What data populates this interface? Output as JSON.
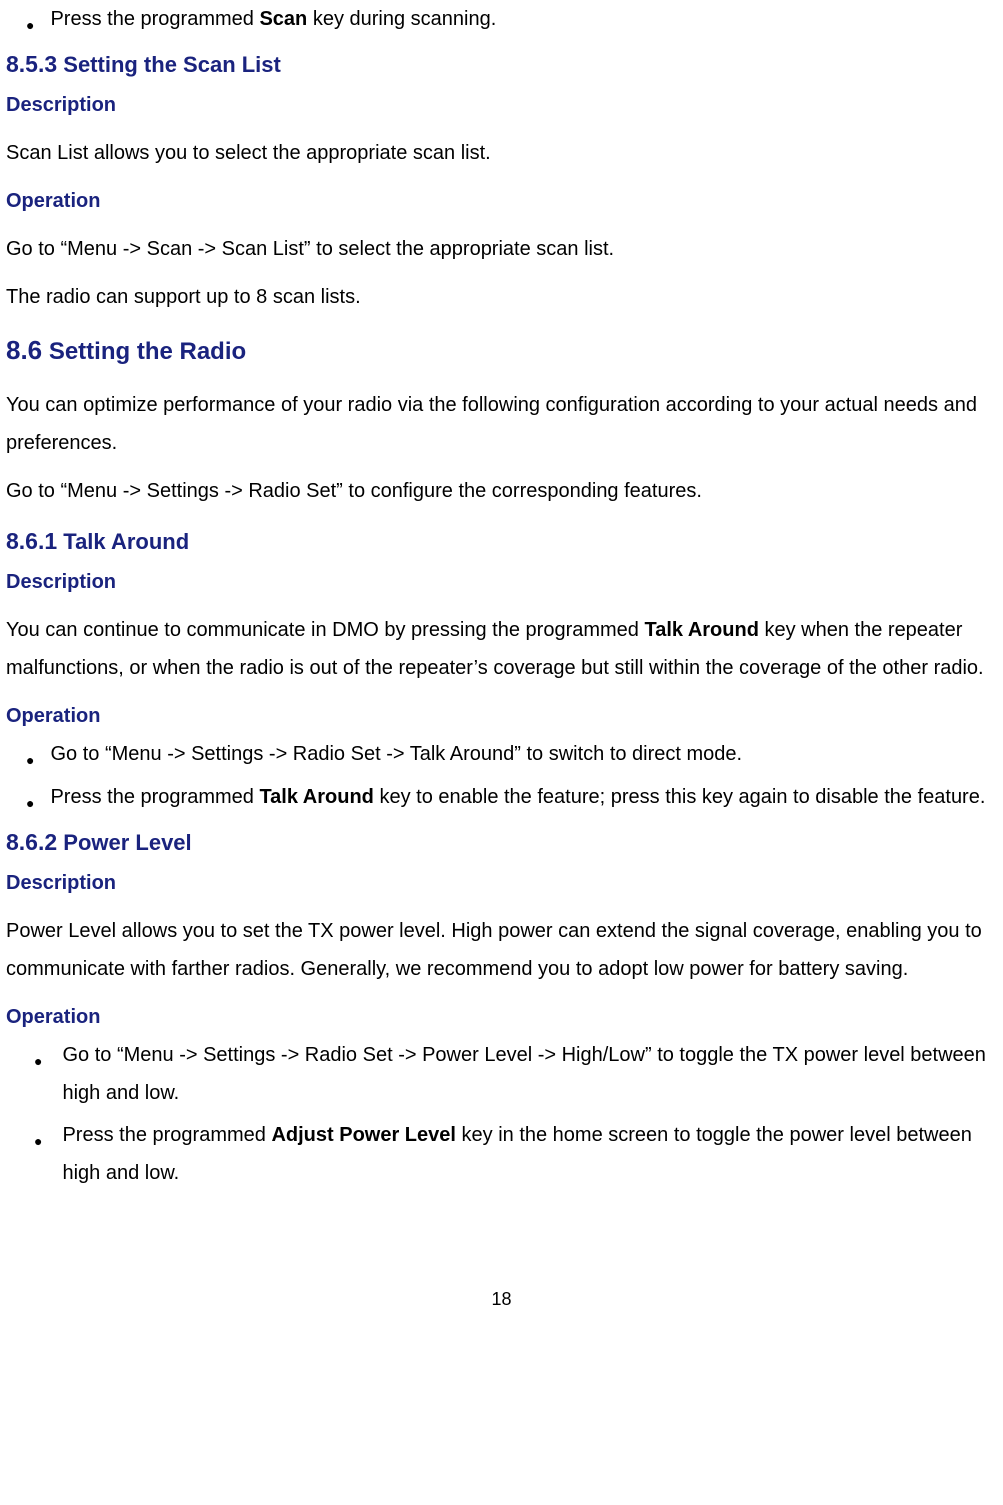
{
  "top_bullet": {
    "pre": "Press the programmed ",
    "bold": "Scan",
    "post": " key during scanning."
  },
  "s853": {
    "num": "8.5.3",
    "title": " Setting the Scan List",
    "desc_label": "Description",
    "desc_text": "Scan List allows you to select the appropriate scan list.",
    "op_label": "Operation",
    "op_text": "Go to “Menu -> Scan -> Scan List” to select the appropriate scan list.",
    "note": "The radio can support up to 8 scan lists."
  },
  "s86": {
    "num": "8.6",
    "title": " Setting the Radio",
    "intro": "You can optimize performance of your radio via the following configuration according to your actual needs and preferences.",
    "path": "Go to “Menu -> Settings -> Radio Set” to configure the corresponding features."
  },
  "s861": {
    "num": "8.6.1",
    "title": " Talk Around",
    "desc_label": "Description",
    "desc_pre": "You can continue to communicate in DMO by pressing the programmed ",
    "desc_bold": "Talk Around",
    "desc_post": " key when the repeater malfunctions, or when the radio is out of the repeater’s coverage but still within the coverage of the other radio.",
    "op_label": "Operation",
    "b1": "Go to “Menu -> Settings -> Radio Set -> Talk Around” to switch to direct mode.",
    "b2_pre": "Press the programmed ",
    "b2_bold": "Talk Around",
    "b2_post": " key to enable the feature; press this key again to disable the feature."
  },
  "s862": {
    "num": "8.6.2",
    "title": " Power Level",
    "desc_label": "Description",
    "desc_text": "Power Level allows you to set the TX power level. High power can extend the signal coverage, enabling you to communicate with farther radios. Generally, we recommend you to adopt low power for battery saving.",
    "op_label": "Operation",
    "b1": "Go to “Menu -> Settings -> Radio Set -> Power Level -> High/Low” to toggle the TX power level between high and low.",
    "b2_pre": "Press the programmed ",
    "b2_bold": "Adjust Power Level",
    "b2_post": " key in the home screen to toggle the power level between high and low."
  },
  "page_number": "18"
}
